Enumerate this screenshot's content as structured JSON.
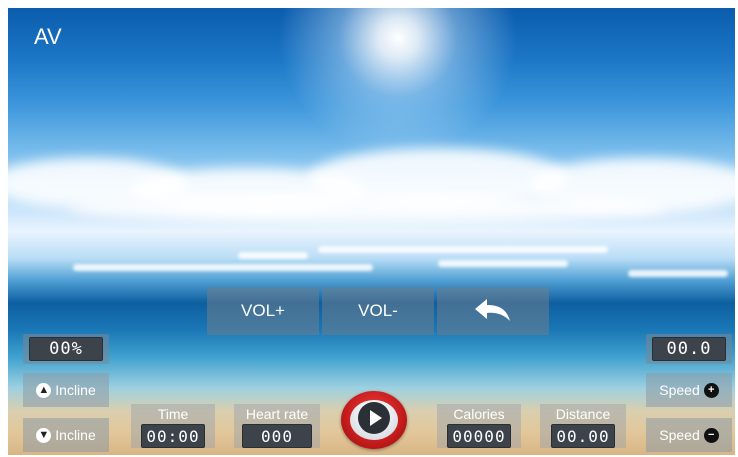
{
  "screen": {
    "title": "AV"
  },
  "volume": {
    "up_label": "VOL+",
    "down_label": "VOL-",
    "back_icon": "back-arrow-icon"
  },
  "incline": {
    "value": "00%",
    "up_label": "Incline",
    "down_label": "Incline"
  },
  "speed": {
    "value": "00.0",
    "up_label": "Speed",
    "down_label": "Speed"
  },
  "stats": {
    "time": {
      "label": "Time",
      "value": "00:00"
    },
    "heart_rate": {
      "label": "Heart rate",
      "value": "000"
    },
    "calories": {
      "label": "Calories",
      "value": "00000"
    },
    "distance": {
      "label": "Distance",
      "value": "00.00"
    }
  },
  "play": {
    "icon": "play-icon",
    "accent": "#c41b1b"
  }
}
